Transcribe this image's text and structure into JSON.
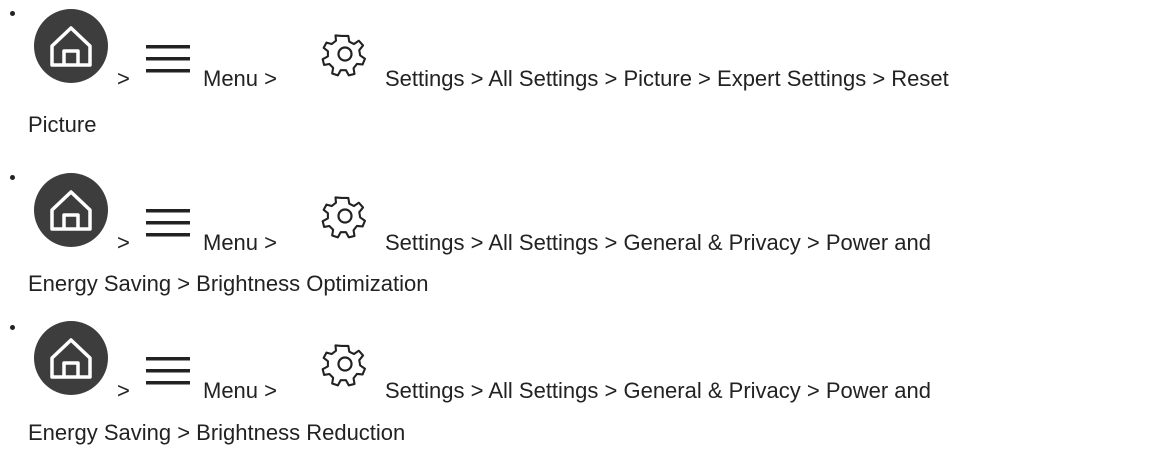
{
  "items": [
    {
      "sep_home": ">",
      "menu_label": "Menu >",
      "path_line1": "Settings > All Settings > Picture > Expert Settings > Reset",
      "path_line2": "Picture"
    },
    {
      "sep_home": ">",
      "menu_label": "Menu >",
      "path_line1": "Settings > All Settings > General & Privacy > Power and",
      "path_line2": "Energy Saving > Brightness Optimization"
    },
    {
      "sep_home": ">",
      "menu_label": "Menu >",
      "path_line1": "Settings > All Settings > General & Privacy > Power and",
      "path_line2": "Energy Saving > Brightness Reduction"
    }
  ],
  "icons": {
    "home": "home-icon",
    "menu": "menu-icon",
    "settings": "gear-icon"
  },
  "colors": {
    "text": "#222222",
    "home_circle": "#3d3d3d",
    "home_glyph": "#ffffff"
  }
}
